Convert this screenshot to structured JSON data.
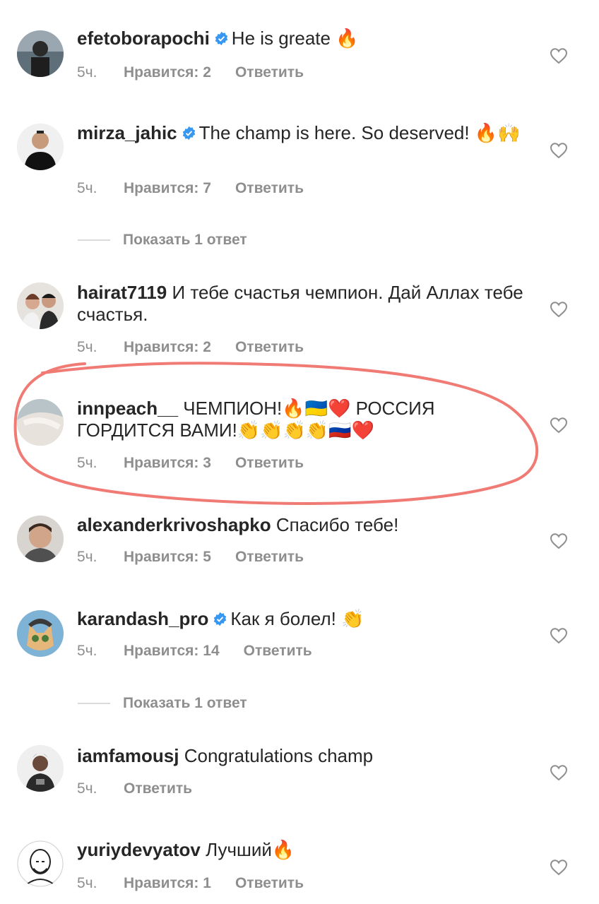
{
  "comments": [
    {
      "username": "efetoborapochi",
      "verified": true,
      "text": "He is greate 🔥",
      "time": "5ч.",
      "likes": "Нравится: 2",
      "reply": "Ответить"
    },
    {
      "username": "mirza_jahic",
      "verified": true,
      "text": "The champ is here. So deserved! 🔥🙌",
      "time": "5ч.",
      "likes": "Нравится: 7",
      "reply": "Ответить"
    },
    {
      "username": "hairat7119",
      "verified": false,
      "text": "И тебе счастья чемпион.  Дай Аллах тебе счастья.",
      "time": "5ч.",
      "likes": "Нравится: 2",
      "reply": "Ответить"
    },
    {
      "username": "innpeach__",
      "verified": false,
      "text": "ЧЕМПИОН!🔥🇺🇦❤️ РОССИЯ ГОРДИТСЯ ВАМИ!👏👏👏👏🇷🇺❤️",
      "time": "5ч.",
      "likes": "Нравится: 3",
      "reply": "Ответить"
    },
    {
      "username": "alexanderkrivoshapko",
      "verified": false,
      "text": "Спасибо тебе!",
      "time": "5ч.",
      "likes": "Нравится: 5",
      "reply": "Ответить"
    },
    {
      "username": "karandash_pro",
      "verified": true,
      "text": "Как я болел! 👏",
      "time": "5ч.",
      "likes": "Нравится: 14",
      "reply": "Ответить"
    },
    {
      "username": "iamfamousj",
      "verified": false,
      "text": "Congratulations champ",
      "time": "5ч.",
      "likes": "",
      "reply": "Ответить"
    },
    {
      "username": "yuriydevyatov",
      "verified": false,
      "text": "Лучший🔥",
      "time": "5ч.",
      "likes": "Нравится: 1",
      "reply": "Ответить"
    }
  ],
  "show_replies": [
    "Показать 1 ответ",
    "Показать 1 ответ"
  ],
  "colors": {
    "verified": "#3897f0",
    "highlight_circle": "#f07a74",
    "meta": "#8e8e8e"
  }
}
